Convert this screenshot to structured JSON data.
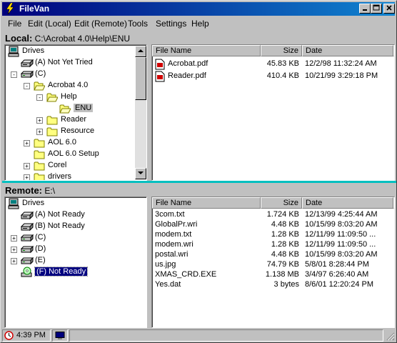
{
  "window": {
    "title": "FileVan"
  },
  "menu": [
    "File",
    "Edit (Local)",
    "Edit (Remote)",
    "Tools",
    "Settings",
    "Help"
  ],
  "local": {
    "label": "Local:",
    "path": "C:\\Acrobat 4.0\\Help\\ENU",
    "tree": [
      {
        "label": "Drives",
        "icon": "computer"
      },
      {
        "label": "(A) Not Yet Tried",
        "icon": "floppy"
      },
      {
        "label": "(C)",
        "icon": "drive",
        "toggle": "-"
      },
      {
        "label": "Acrobat 4.0",
        "icon": "folder-open",
        "toggle": "-"
      },
      {
        "label": "Help",
        "icon": "folder-open",
        "toggle": "-"
      },
      {
        "label": "ENU",
        "icon": "folder-open",
        "selected": true
      },
      {
        "label": "Reader",
        "icon": "folder",
        "toggle": "+"
      },
      {
        "label": "Resource",
        "icon": "folder",
        "toggle": "+"
      },
      {
        "label": "AOL 6.0",
        "icon": "folder",
        "toggle": "+"
      },
      {
        "label": "AOL 6.0 Setup",
        "icon": "folder"
      },
      {
        "label": "Corel",
        "icon": "folder",
        "toggle": "+"
      },
      {
        "label": "drivers",
        "icon": "folder",
        "toggle": "+"
      }
    ],
    "columns": [
      "File Name",
      "Size",
      "Date"
    ],
    "files": [
      {
        "name": "Acrobat.pdf",
        "size": "45.83 KB",
        "date": "12/2/98 11:32:24 AM"
      },
      {
        "name": "Reader.pdf",
        "size": "410.4 KB",
        "date": "10/21/99 3:29:18 PM"
      }
    ]
  },
  "remote": {
    "label": "Remote:",
    "path": "E:\\",
    "tree": [
      {
        "label": "Drives",
        "icon": "computer"
      },
      {
        "label": "(A) Not Ready",
        "icon": "floppy"
      },
      {
        "label": "(B) Not Ready",
        "icon": "floppy"
      },
      {
        "label": "(C)",
        "icon": "drive",
        "toggle": "+"
      },
      {
        "label": "(D)",
        "icon": "drive",
        "toggle": "+"
      },
      {
        "label": "(E)",
        "icon": "drive",
        "toggle": "+"
      },
      {
        "label": "(F) Not Ready",
        "icon": "cdrom",
        "selected": true
      }
    ],
    "columns": [
      "File Name",
      "Size",
      "Date"
    ],
    "files": [
      {
        "name": "3com.txt",
        "size": "1.724 KB",
        "date": "12/13/99 4:25:44 AM"
      },
      {
        "name": "GlobalPr.wri",
        "size": "4.48 KB",
        "date": "10/15/99 8:03:20 AM"
      },
      {
        "name": "modem.txt",
        "size": "1.28 KB",
        "date": "12/11/99 11:09:50 ..."
      },
      {
        "name": "modem.wri",
        "size": "1.28 KB",
        "date": "12/11/99 11:09:50 ..."
      },
      {
        "name": "postal.wri",
        "size": "4.48 KB",
        "date": "10/15/99 8:03:20 AM"
      },
      {
        "name": "us.jpg",
        "size": "74.79 KB",
        "date": "5/8/01 8:28:44 PM"
      },
      {
        "name": "XMAS_CRD.EXE",
        "size": "1.138 MB",
        "date": "3/4/97 6:26:40 AM"
      },
      {
        "name": "Yes.dat",
        "size": "3 bytes",
        "date": "8/6/01 12:20:24 PM"
      }
    ]
  },
  "status": {
    "time": "4:39 PM"
  }
}
